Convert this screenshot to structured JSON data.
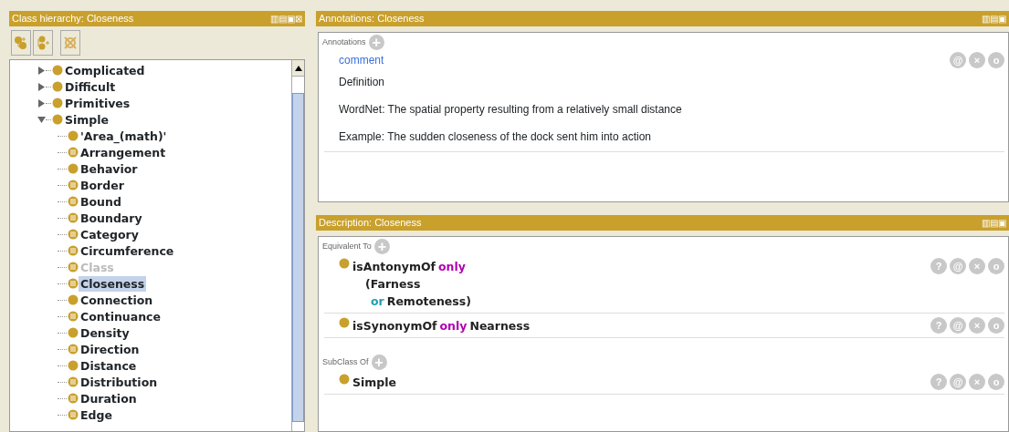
{
  "class_hierarchy": {
    "title": "Class hierarchy: Closeness",
    "header_buttons": [
      "▥",
      "▤",
      "▣",
      "⊠"
    ],
    "tree": [
      {
        "label": "Complicated",
        "kind": "primitive",
        "expanded": false,
        "selected": false,
        "disabled": false
      },
      {
        "label": "Difficult",
        "kind": "primitive",
        "expanded": false,
        "selected": false,
        "disabled": false
      },
      {
        "label": "Primitives",
        "kind": "primitive",
        "expanded": false,
        "selected": false,
        "disabled": false
      },
      {
        "label": "Simple",
        "kind": "primitive",
        "expanded": true,
        "selected": false,
        "disabled": false,
        "children": [
          {
            "label": "'Area_(math)'",
            "kind": "primitive",
            "selected": false,
            "disabled": false
          },
          {
            "label": "Arrangement",
            "kind": "defined",
            "selected": false,
            "disabled": false
          },
          {
            "label": "Behavior",
            "kind": "primitive",
            "selected": false,
            "disabled": false
          },
          {
            "label": "Border",
            "kind": "defined",
            "selected": false,
            "disabled": false
          },
          {
            "label": "Bound",
            "kind": "defined",
            "selected": false,
            "disabled": false
          },
          {
            "label": "Boundary",
            "kind": "defined",
            "selected": false,
            "disabled": false
          },
          {
            "label": "Category",
            "kind": "defined",
            "selected": false,
            "disabled": false
          },
          {
            "label": "Circumference",
            "kind": "defined",
            "selected": false,
            "disabled": false
          },
          {
            "label": "Class",
            "kind": "defined",
            "selected": false,
            "disabled": true
          },
          {
            "label": "Closeness",
            "kind": "defined",
            "selected": true,
            "disabled": false
          },
          {
            "label": "Connection",
            "kind": "primitive",
            "selected": false,
            "disabled": false
          },
          {
            "label": "Continuance",
            "kind": "defined",
            "selected": false,
            "disabled": false
          },
          {
            "label": "Density",
            "kind": "primitive",
            "selected": false,
            "disabled": false
          },
          {
            "label": "Direction",
            "kind": "defined",
            "selected": false,
            "disabled": false
          },
          {
            "label": "Distance",
            "kind": "primitive",
            "selected": false,
            "disabled": false
          },
          {
            "label": "Distribution",
            "kind": "defined",
            "selected": false,
            "disabled": false
          },
          {
            "label": "Duration",
            "kind": "defined",
            "selected": false,
            "disabled": false
          },
          {
            "label": "Edge",
            "kind": "defined",
            "selected": false,
            "disabled": false
          }
        ]
      }
    ]
  },
  "annotations": {
    "title": "Annotations: Closeness",
    "header_buttons": [
      "▥",
      "▤",
      "▣"
    ],
    "section_label": "Annotations",
    "add_button": "+",
    "items": [
      {
        "property": "comment",
        "lines": [
          "Definition",
          "WordNet: The spatial property resulting from a relatively small distance",
          "Example: The sudden closeness of the dock sent him into action"
        ],
        "buttons": [
          "@",
          "×",
          "o"
        ]
      }
    ]
  },
  "description": {
    "title": "Description: Closeness",
    "header_buttons": [
      "▥",
      "▤",
      "▣"
    ],
    "sections": [
      {
        "label": "Equivalent To",
        "add_button": "+",
        "items": [
          {
            "lines": [
              [
                {
                  "text": "isAntonymOf",
                  "kind": "name"
                },
                {
                  "text": "only",
                  "kind": "keyword"
                }
              ],
              [
                {
                  "text": "(Farness",
                  "kind": "name"
                }
              ],
              [
                {
                  "text": "or",
                  "kind": "operator"
                },
                {
                  "text": "Remoteness)",
                  "kind": "name"
                }
              ]
            ],
            "buttons": [
              "?",
              "@",
              "×",
              "o"
            ]
          },
          {
            "lines": [
              [
                {
                  "text": "isSynonymOf",
                  "kind": "name"
                },
                {
                  "text": "only",
                  "kind": "keyword"
                },
                {
                  "text": "Nearness",
                  "kind": "plain"
                }
              ]
            ],
            "buttons": [
              "?",
              "@",
              "×",
              "o"
            ]
          }
        ]
      },
      {
        "label": "SubClass Of",
        "add_button": "+",
        "items": [
          {
            "lines": [
              [
                {
                  "text": "Simple",
                  "kind": "name"
                }
              ]
            ],
            "buttons": [
              "?",
              "@",
              "×",
              "o"
            ]
          }
        ]
      }
    ]
  }
}
